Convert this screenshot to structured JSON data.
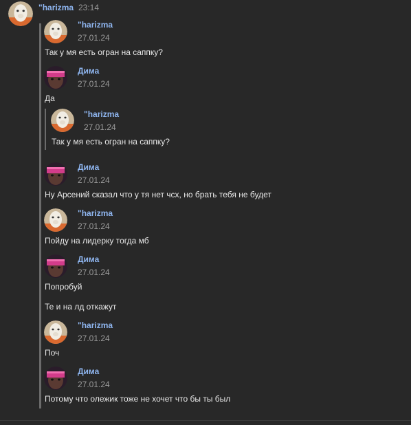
{
  "header": {
    "author": "\"harizma",
    "time": "23:14"
  },
  "colors": {
    "name_accent": "#8fb6f0",
    "background": "#282828",
    "quote_line": "#6b6b6b"
  },
  "messages": [
    {
      "author": "\"harizma",
      "date": "27.01.24",
      "text": "Так у мя есть огран на саппку?",
      "avatar": "llama-avatar"
    },
    {
      "author": "Дима",
      "date": "27.01.24",
      "text": "Да",
      "avatar": "anime-avatar"
    },
    {
      "author": "Дима",
      "date": "27.01.24",
      "text": "Ну Арсений сказал что у тя нет чсх, но брать тебя не будет",
      "avatar": "anime-avatar"
    },
    {
      "author": "\"harizma",
      "date": "27.01.24",
      "text": "Пойду на лидерку тогда мб",
      "avatar": "llama-avatar"
    },
    {
      "author": "Дима",
      "date": "27.01.24",
      "text": "Попробуй",
      "text2": "Те и на лд откажут",
      "avatar": "anime-avatar"
    },
    {
      "author": "\"harizma",
      "date": "27.01.24",
      "text": "Поч",
      "avatar": "llama-avatar"
    },
    {
      "author": "Дима",
      "date": "27.01.24",
      "text": "Потому что олежик тоже не хочет что бы ты был",
      "avatar": "anime-avatar"
    }
  ],
  "nested_quote": {
    "author": "\"harizma",
    "date": "27.01.24",
    "text": "Так у мя есть огран на саппку?",
    "avatar": "llama-avatar"
  }
}
